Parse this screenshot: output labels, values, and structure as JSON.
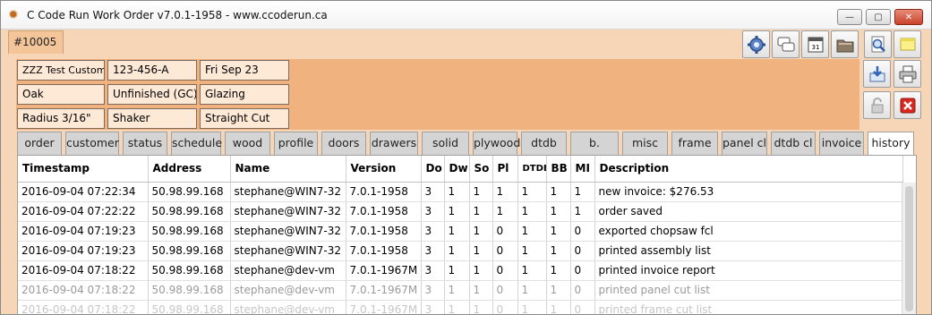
{
  "window": {
    "title": "C Code Run Work Order v7.0.1-1958 - www.ccoderun.ca",
    "controls": {
      "minimize": "—",
      "maximize": "▢",
      "close": "✕"
    }
  },
  "order_tab": {
    "label": "#10005"
  },
  "toolbar": {
    "buttons": [
      {
        "name": "settings-gear-icon"
      },
      {
        "name": "chat-bubbles-icon"
      },
      {
        "name": "calendar-icon",
        "text": "31"
      },
      {
        "name": "folder-icon"
      },
      {
        "name": "search-document-icon"
      },
      {
        "name": "sticky-note-icon"
      }
    ]
  },
  "header": {
    "customer": "ZZZ Test Customer",
    "phone": "123-456-A",
    "date": "Fri Sep 23",
    "wood": "Oak",
    "finish": "Unfinished (GC)",
    "glazing": "Glazing",
    "radius": "Radius 3/16\"",
    "style": "Shaker",
    "cut": "Straight Cut"
  },
  "side_buttons": [
    {
      "name": "export-icon"
    },
    {
      "name": "printer-icon"
    },
    {
      "name": "lock-icon"
    },
    {
      "name": "delete-icon"
    }
  ],
  "tabs": [
    {
      "label": "order"
    },
    {
      "label": "customer"
    },
    {
      "label": "status"
    },
    {
      "label": "schedule"
    },
    {
      "label": "wood"
    },
    {
      "label": "profile"
    },
    {
      "label": "doors"
    },
    {
      "label": "drawers"
    },
    {
      "label": "solid"
    },
    {
      "label": "plywood"
    },
    {
      "label": "dtdb"
    },
    {
      "label": "b. blocks"
    },
    {
      "label": "misc"
    },
    {
      "label": "frame cl"
    },
    {
      "label": "panel cl"
    },
    {
      "label": "dtdb cl"
    },
    {
      "label": "invoice"
    },
    {
      "label": "history"
    }
  ],
  "active_tab": "history",
  "table": {
    "columns": [
      "Timestamp",
      "Address",
      "Name",
      "Version",
      "Do",
      "Dw",
      "So",
      "Pl",
      "DTDB",
      "BB",
      "MI",
      "Description"
    ],
    "rows": [
      [
        "2016-09-04 07:22:34",
        "50.98.99.168",
        "stephane@WIN7-32",
        "7.0.1-1958",
        "3",
        "1",
        "1",
        "1",
        "1",
        "1",
        "1",
        "new invoice: $276.53"
      ],
      [
        "2016-09-04 07:22:22",
        "50.98.99.168",
        "stephane@WIN7-32",
        "7.0.1-1958",
        "3",
        "1",
        "1",
        "1",
        "1",
        "1",
        "1",
        "order saved"
      ],
      [
        "2016-09-04 07:19:23",
        "50.98.99.168",
        "stephane@WIN7-32",
        "7.0.1-1958",
        "3",
        "1",
        "1",
        "0",
        "1",
        "1",
        "0",
        "exported chopsaw fcl"
      ],
      [
        "2016-09-04 07:19:23",
        "50.98.99.168",
        "stephane@WIN7-32",
        "7.0.1-1958",
        "3",
        "1",
        "1",
        "0",
        "1",
        "1",
        "0",
        "printed assembly list"
      ],
      [
        "2016-09-04 07:18:22",
        "50.98.99.168",
        "stephane@dev-vm",
        "7.0.1-1967M",
        "3",
        "1",
        "1",
        "0",
        "1",
        "1",
        "0",
        "printed invoice report"
      ],
      [
        "2016-09-04 07:18:22",
        "50.98.99.168",
        "stephane@dev-vm",
        "7.0.1-1967M",
        "3",
        "1",
        "1",
        "0",
        "1",
        "1",
        "0",
        "printed panel cut list"
      ],
      [
        "2016-09-04 07:18:22",
        "50.98.99.168",
        "stephane@dev-vm",
        "7.0.1-1967M",
        "3",
        "1",
        "1",
        "0",
        "1",
        "1",
        "0",
        "printed frame cut list"
      ]
    ]
  },
  "colors": {
    "window_bg": "#f7d6b7",
    "header_panel": "#f0b27f",
    "info_box": "#fde9d6",
    "tab_inactive": "#d4d4d4",
    "tab_active": "#ffffff"
  }
}
